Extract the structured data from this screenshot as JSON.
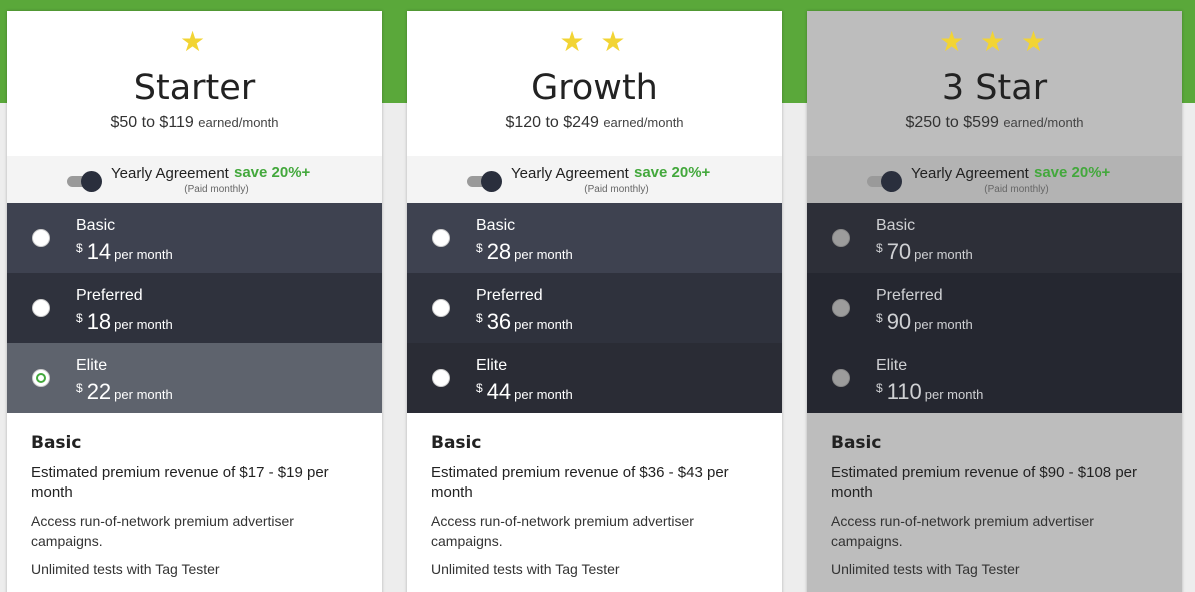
{
  "colors": {
    "accent_green": "#43a83c",
    "band_green": "#5aa83a",
    "star": "#f2d434"
  },
  "plans": [
    {
      "stars": "★",
      "title": "Starter",
      "range": "$50 to $119",
      "range_unit": "earned/month",
      "yearly_label": "Yearly Agreement",
      "save_label": "save 20%+",
      "paid_note": "(Paid monthly)",
      "tiers": [
        {
          "name": "Basic",
          "currency": "$",
          "amount": "14",
          "per": "per month"
        },
        {
          "name": "Preferred",
          "currency": "$",
          "amount": "18",
          "per": "per month"
        },
        {
          "name": "Elite",
          "currency": "$",
          "amount": "22",
          "per": "per month"
        }
      ],
      "details": {
        "heading": "Basic",
        "estimate": "Estimated premium revenue of $17 - $19 per month",
        "feature1": "Access run-of-network premium advertiser campaigns.",
        "feature2": "Unlimited tests with Tag Tester"
      }
    },
    {
      "stars": "★ ★",
      "title": "Growth",
      "range": "$120 to $249",
      "range_unit": "earned/month",
      "yearly_label": "Yearly Agreement",
      "save_label": "save 20%+",
      "paid_note": "(Paid monthly)",
      "tiers": [
        {
          "name": "Basic",
          "currency": "$",
          "amount": "28",
          "per": "per month"
        },
        {
          "name": "Preferred",
          "currency": "$",
          "amount": "36",
          "per": "per month"
        },
        {
          "name": "Elite",
          "currency": "$",
          "amount": "44",
          "per": "per month"
        }
      ],
      "details": {
        "heading": "Basic",
        "estimate": "Estimated premium revenue of $36 - $43 per month",
        "feature1": "Access run-of-network premium advertiser campaigns.",
        "feature2": "Unlimited tests with Tag Tester"
      }
    },
    {
      "stars": "★ ★ ★",
      "title": "3 Star",
      "range": "$250 to $599",
      "range_unit": "earned/month",
      "yearly_label": "Yearly Agreement",
      "save_label": "save 20%+",
      "paid_note": "(Paid monthly)",
      "tiers": [
        {
          "name": "Basic",
          "currency": "$",
          "amount": "70",
          "per": "per month"
        },
        {
          "name": "Preferred",
          "currency": "$",
          "amount": "90",
          "per": "per month"
        },
        {
          "name": "Elite",
          "currency": "$",
          "amount": "110",
          "per": "per month"
        }
      ],
      "details": {
        "heading": "Basic",
        "estimate": "Estimated premium revenue of $90 - $108 per month",
        "feature1": "Access run-of-network premium advertiser campaigns.",
        "feature2": "Unlimited tests with Tag Tester"
      }
    }
  ]
}
